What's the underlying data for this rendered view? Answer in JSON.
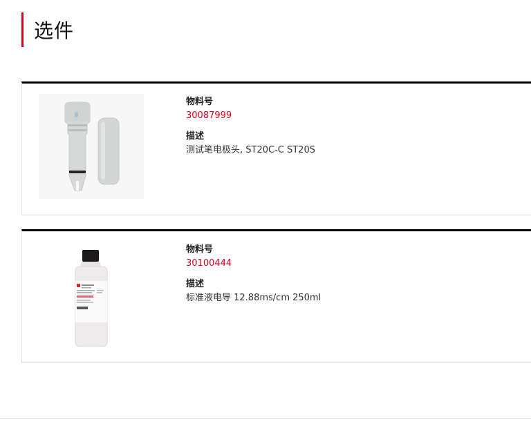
{
  "section": {
    "title": "选件"
  },
  "products": [
    {
      "part_number_label": "物料号",
      "part_number": "30087999",
      "description_label": "描述",
      "description": "测试笔电极头, ST20C-C ST20S",
      "image_icon": "electrode-tip-with-cap-icon"
    },
    {
      "part_number_label": "物料号",
      "part_number": "30100444",
      "description_label": "描述",
      "description": "标准液电导 12.88ms/cm 250ml",
      "image_icon": "solution-bottle-icon"
    }
  ],
  "colors": {
    "accent": "#d6001c",
    "card_top_border": "#000000",
    "card_border": "#e2e2e2"
  }
}
